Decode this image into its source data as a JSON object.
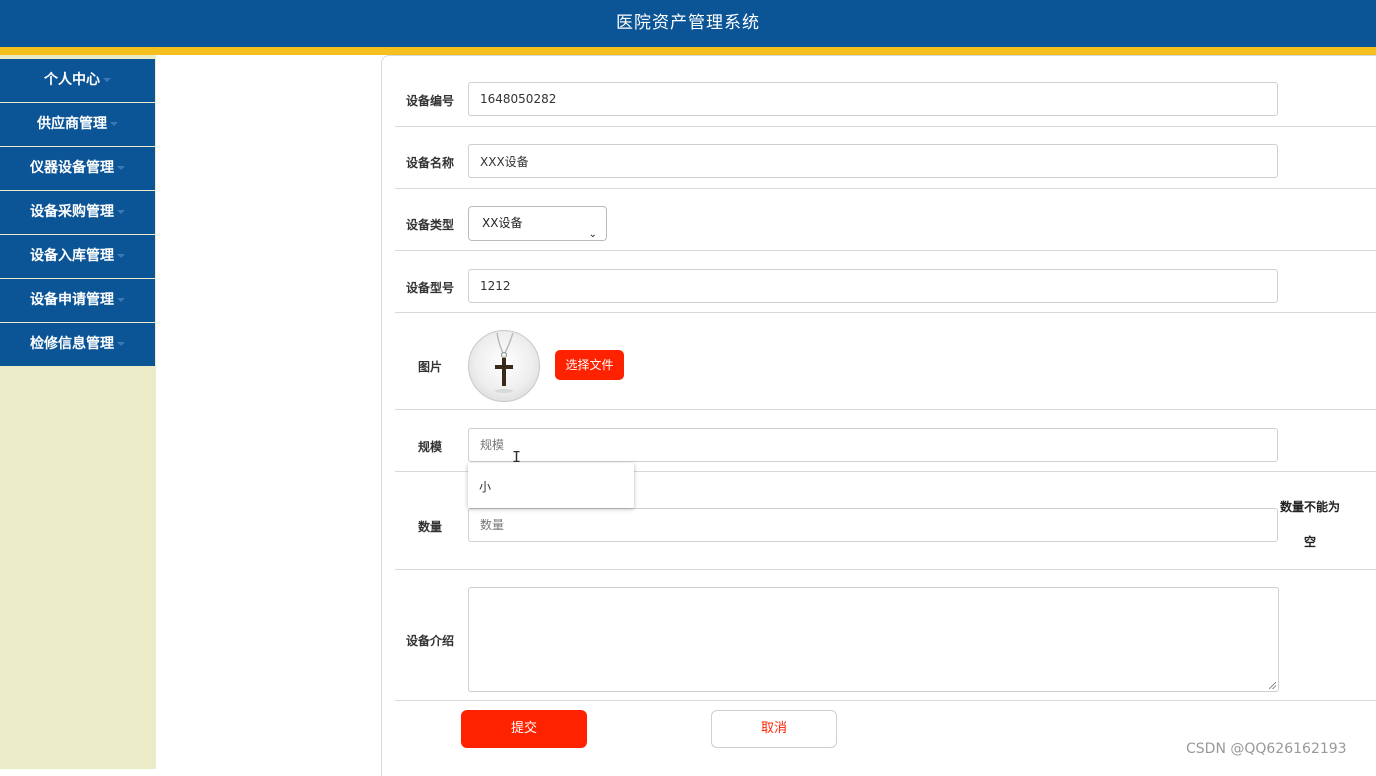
{
  "header": {
    "title": "医院资产管理系统"
  },
  "sidebar": {
    "items": [
      {
        "label": "个人中心"
      },
      {
        "label": "供应商管理"
      },
      {
        "label": "仪器设备管理"
      },
      {
        "label": "设备采购管理"
      },
      {
        "label": "设备入库管理"
      },
      {
        "label": "设备申请管理"
      },
      {
        "label": "检修信息管理"
      }
    ]
  },
  "form": {
    "device_no": {
      "label": "设备编号",
      "value": "1648050282"
    },
    "device_name": {
      "label": "设备名称",
      "value": "XXX设备"
    },
    "device_type": {
      "label": "设备类型",
      "value": "XX设备"
    },
    "device_model": {
      "label": "设备型号",
      "value": "1212"
    },
    "image": {
      "label": "图片",
      "button": "选择文件"
    },
    "scale": {
      "label": "规模",
      "placeholder": "规模",
      "suggestion": "小"
    },
    "quantity": {
      "label": "数量",
      "placeholder": "数量",
      "error_line1": "数量不能为",
      "error_line2": "空"
    },
    "intro": {
      "label": "设备介绍",
      "value": ""
    },
    "submit_label": "提交",
    "cancel_label": "取消"
  },
  "watermark": "CSDN @QQ626162193"
}
